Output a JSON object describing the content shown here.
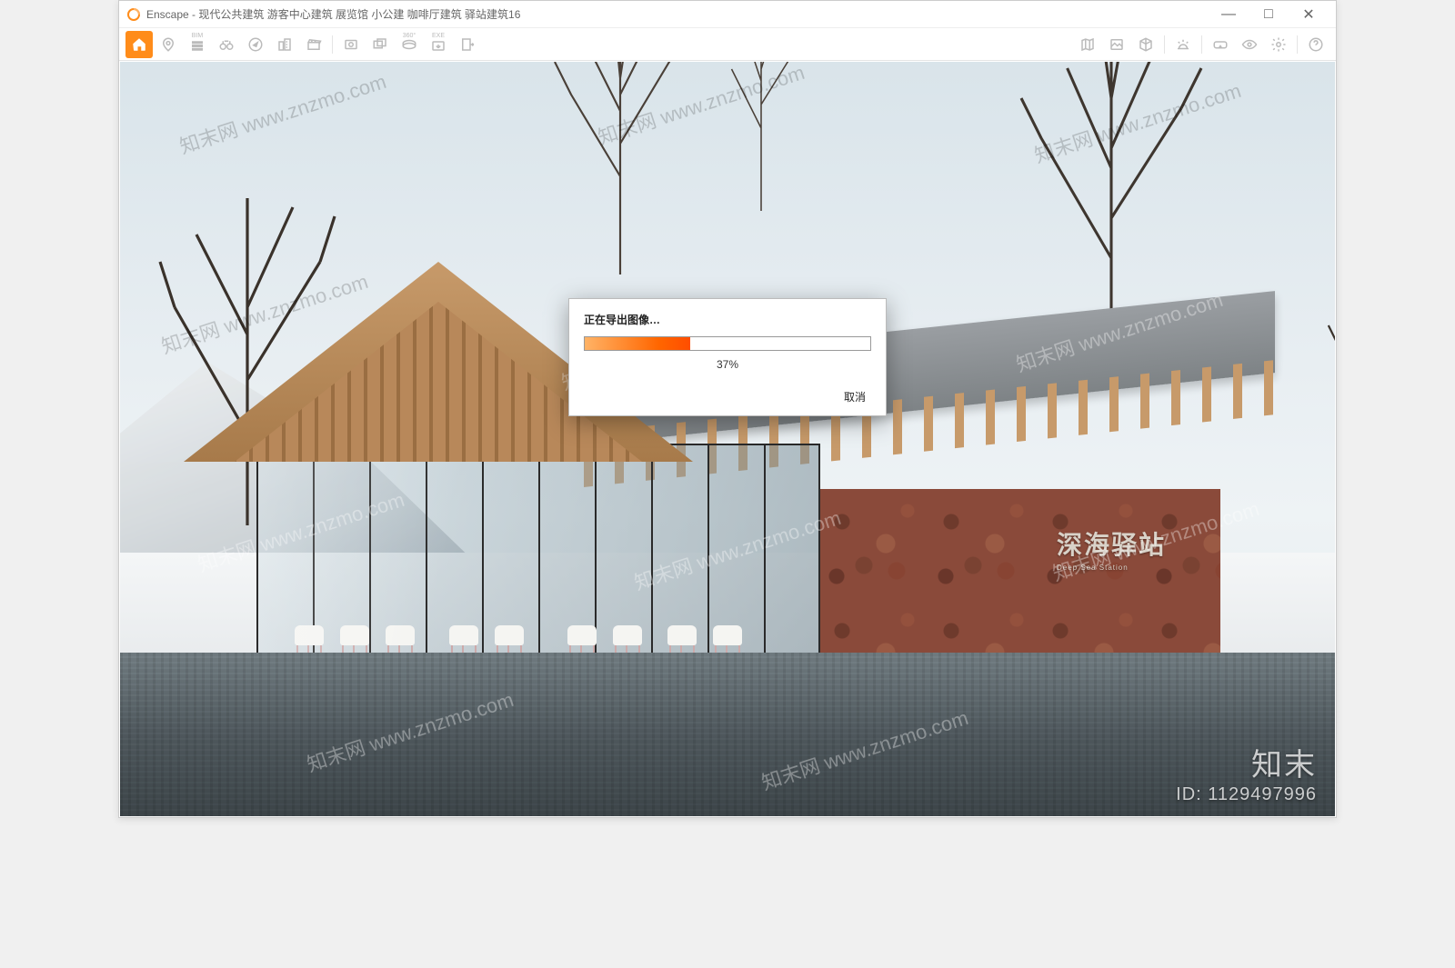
{
  "app": {
    "name": "Enscape",
    "title_prefix": "Enscape - ",
    "document_title": "现代公共建筑 游客中心建筑 展览馆 小公建 咖啡厅建筑 驿站建筑16"
  },
  "window_controls": {
    "min": "—",
    "max": "□",
    "close": "✕"
  },
  "toolbar_left": [
    {
      "id": "home",
      "name": "home-icon",
      "active": true
    },
    {
      "id": "pin",
      "name": "location-pin-icon"
    },
    {
      "id": "bim",
      "name": "bim-manage-icon",
      "label_top": "BIM"
    },
    {
      "id": "binoc",
      "name": "binoculars-icon"
    },
    {
      "id": "compass",
      "name": "compass-icon"
    },
    {
      "id": "buildings",
      "name": "buildings-icon"
    },
    {
      "id": "clapper",
      "name": "video-clapper-icon"
    },
    {
      "id": "sep1",
      "sep": true
    },
    {
      "id": "screenshot",
      "name": "screenshot-icon"
    },
    {
      "id": "batch",
      "name": "batch-render-icon"
    },
    {
      "id": "pano",
      "name": "panorama-360-icon",
      "label_top": "360°"
    },
    {
      "id": "exe",
      "name": "export-exe-icon",
      "label_top": "EXE"
    },
    {
      "id": "export",
      "name": "export-file-icon"
    }
  ],
  "toolbar_right": [
    {
      "id": "map",
      "name": "minimap-icon"
    },
    {
      "id": "asset",
      "name": "asset-library-icon"
    },
    {
      "id": "cube",
      "name": "view-cube-icon"
    },
    {
      "id": "sep2",
      "sep": true
    },
    {
      "id": "sun",
      "name": "sun-settings-icon"
    },
    {
      "id": "sep3",
      "sep": true
    },
    {
      "id": "vr",
      "name": "vr-headset-icon"
    },
    {
      "id": "eye",
      "name": "visual-settings-icon"
    },
    {
      "id": "gear",
      "name": "settings-gear-icon"
    },
    {
      "id": "sep4",
      "sep": true
    },
    {
      "id": "help",
      "name": "help-icon"
    }
  ],
  "dialog": {
    "title": "正在导出图像…",
    "percent_text": "37%",
    "percent_value": 37,
    "cancel": "取消"
  },
  "scene": {
    "building_sign": "深海驿站",
    "building_sign_en": "Deep Sea Station"
  },
  "watermark": {
    "repeat_text": "知末网 www.znzmo.com",
    "corner_brand": "知末",
    "corner_id": "ID: 1129497996"
  },
  "colors": {
    "accent": "#ff8c1a",
    "progress_start": "#ffb366",
    "progress_end": "#ff4d00"
  }
}
